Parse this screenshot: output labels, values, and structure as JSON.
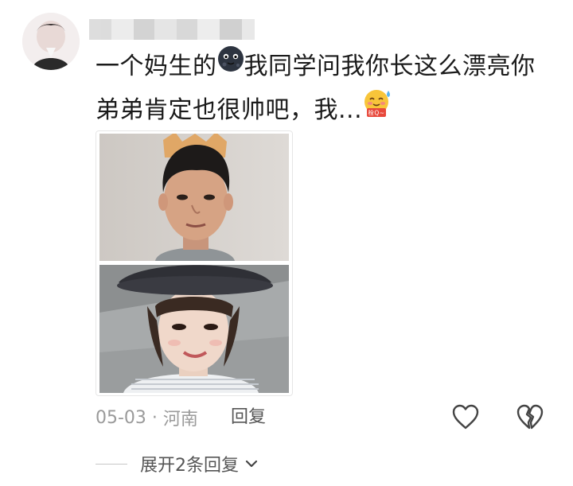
{
  "comment": {
    "text_before_emoji": "一个妈生的",
    "text_after_emoji": "我同学问我你长这么漂亮你弟弟肯定也很帅吧，我...",
    "emoji_1": "moon-face-emoji",
    "emoji_2": "sweating-blush-emoji",
    "emoji_2_badge": "栓Q~"
  },
  "meta": {
    "date": "05-03",
    "separator": " · ",
    "location": "河南",
    "reply_label": "回复"
  },
  "expand": {
    "label": "展开2条回复"
  },
  "icons": {
    "like": "heart-outline-icon",
    "dislike": "broken-heart-outline-icon",
    "expand": "chevron-down-icon"
  },
  "colors": {
    "text": "#1a1a1a",
    "meta": "#9a9a9a",
    "secondary": "#555555"
  }
}
